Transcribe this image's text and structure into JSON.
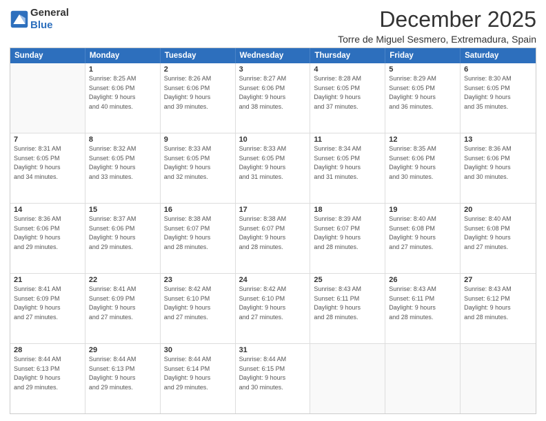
{
  "header": {
    "logo_general": "General",
    "logo_blue": "Blue",
    "month": "December 2025",
    "location": "Torre de Miguel Sesmero, Extremadura, Spain"
  },
  "days_of_week": [
    "Sunday",
    "Monday",
    "Tuesday",
    "Wednesday",
    "Thursday",
    "Friday",
    "Saturday"
  ],
  "weeks": [
    [
      {
        "day": "",
        "sunrise": "",
        "sunset": "",
        "daylight": ""
      },
      {
        "day": "1",
        "sunrise": "Sunrise: 8:25 AM",
        "sunset": "Sunset: 6:06 PM",
        "daylight": "Daylight: 9 hours and 40 minutes."
      },
      {
        "day": "2",
        "sunrise": "Sunrise: 8:26 AM",
        "sunset": "Sunset: 6:06 PM",
        "daylight": "Daylight: 9 hours and 39 minutes."
      },
      {
        "day": "3",
        "sunrise": "Sunrise: 8:27 AM",
        "sunset": "Sunset: 6:06 PM",
        "daylight": "Daylight: 9 hours and 38 minutes."
      },
      {
        "day": "4",
        "sunrise": "Sunrise: 8:28 AM",
        "sunset": "Sunset: 6:05 PM",
        "daylight": "Daylight: 9 hours and 37 minutes."
      },
      {
        "day": "5",
        "sunrise": "Sunrise: 8:29 AM",
        "sunset": "Sunset: 6:05 PM",
        "daylight": "Daylight: 9 hours and 36 minutes."
      },
      {
        "day": "6",
        "sunrise": "Sunrise: 8:30 AM",
        "sunset": "Sunset: 6:05 PM",
        "daylight": "Daylight: 9 hours and 35 minutes."
      }
    ],
    [
      {
        "day": "7",
        "sunrise": "Sunrise: 8:31 AM",
        "sunset": "Sunset: 6:05 PM",
        "daylight": "Daylight: 9 hours and 34 minutes."
      },
      {
        "day": "8",
        "sunrise": "Sunrise: 8:32 AM",
        "sunset": "Sunset: 6:05 PM",
        "daylight": "Daylight: 9 hours and 33 minutes."
      },
      {
        "day": "9",
        "sunrise": "Sunrise: 8:33 AM",
        "sunset": "Sunset: 6:05 PM",
        "daylight": "Daylight: 9 hours and 32 minutes."
      },
      {
        "day": "10",
        "sunrise": "Sunrise: 8:33 AM",
        "sunset": "Sunset: 6:05 PM",
        "daylight": "Daylight: 9 hours and 31 minutes."
      },
      {
        "day": "11",
        "sunrise": "Sunrise: 8:34 AM",
        "sunset": "Sunset: 6:05 PM",
        "daylight": "Daylight: 9 hours and 31 minutes."
      },
      {
        "day": "12",
        "sunrise": "Sunrise: 8:35 AM",
        "sunset": "Sunset: 6:06 PM",
        "daylight": "Daylight: 9 hours and 30 minutes."
      },
      {
        "day": "13",
        "sunrise": "Sunrise: 8:36 AM",
        "sunset": "Sunset: 6:06 PM",
        "daylight": "Daylight: 9 hours and 30 minutes."
      }
    ],
    [
      {
        "day": "14",
        "sunrise": "Sunrise: 8:36 AM",
        "sunset": "Sunset: 6:06 PM",
        "daylight": "Daylight: 9 hours and 29 minutes."
      },
      {
        "day": "15",
        "sunrise": "Sunrise: 8:37 AM",
        "sunset": "Sunset: 6:06 PM",
        "daylight": "Daylight: 9 hours and 29 minutes."
      },
      {
        "day": "16",
        "sunrise": "Sunrise: 8:38 AM",
        "sunset": "Sunset: 6:07 PM",
        "daylight": "Daylight: 9 hours and 28 minutes."
      },
      {
        "day": "17",
        "sunrise": "Sunrise: 8:38 AM",
        "sunset": "Sunset: 6:07 PM",
        "daylight": "Daylight: 9 hours and 28 minutes."
      },
      {
        "day": "18",
        "sunrise": "Sunrise: 8:39 AM",
        "sunset": "Sunset: 6:07 PM",
        "daylight": "Daylight: 9 hours and 28 minutes."
      },
      {
        "day": "19",
        "sunrise": "Sunrise: 8:40 AM",
        "sunset": "Sunset: 6:08 PM",
        "daylight": "Daylight: 9 hours and 27 minutes."
      },
      {
        "day": "20",
        "sunrise": "Sunrise: 8:40 AM",
        "sunset": "Sunset: 6:08 PM",
        "daylight": "Daylight: 9 hours and 27 minutes."
      }
    ],
    [
      {
        "day": "21",
        "sunrise": "Sunrise: 8:41 AM",
        "sunset": "Sunset: 6:09 PM",
        "daylight": "Daylight: 9 hours and 27 minutes."
      },
      {
        "day": "22",
        "sunrise": "Sunrise: 8:41 AM",
        "sunset": "Sunset: 6:09 PM",
        "daylight": "Daylight: 9 hours and 27 minutes."
      },
      {
        "day": "23",
        "sunrise": "Sunrise: 8:42 AM",
        "sunset": "Sunset: 6:10 PM",
        "daylight": "Daylight: 9 hours and 27 minutes."
      },
      {
        "day": "24",
        "sunrise": "Sunrise: 8:42 AM",
        "sunset": "Sunset: 6:10 PM",
        "daylight": "Daylight: 9 hours and 27 minutes."
      },
      {
        "day": "25",
        "sunrise": "Sunrise: 8:43 AM",
        "sunset": "Sunset: 6:11 PM",
        "daylight": "Daylight: 9 hours and 28 minutes."
      },
      {
        "day": "26",
        "sunrise": "Sunrise: 8:43 AM",
        "sunset": "Sunset: 6:11 PM",
        "daylight": "Daylight: 9 hours and 28 minutes."
      },
      {
        "day": "27",
        "sunrise": "Sunrise: 8:43 AM",
        "sunset": "Sunset: 6:12 PM",
        "daylight": "Daylight: 9 hours and 28 minutes."
      }
    ],
    [
      {
        "day": "28",
        "sunrise": "Sunrise: 8:44 AM",
        "sunset": "Sunset: 6:13 PM",
        "daylight": "Daylight: 9 hours and 29 minutes."
      },
      {
        "day": "29",
        "sunrise": "Sunrise: 8:44 AM",
        "sunset": "Sunset: 6:13 PM",
        "daylight": "Daylight: 9 hours and 29 minutes."
      },
      {
        "day": "30",
        "sunrise": "Sunrise: 8:44 AM",
        "sunset": "Sunset: 6:14 PM",
        "daylight": "Daylight: 9 hours and 29 minutes."
      },
      {
        "day": "31",
        "sunrise": "Sunrise: 8:44 AM",
        "sunset": "Sunset: 6:15 PM",
        "daylight": "Daylight: 9 hours and 30 minutes."
      },
      {
        "day": "",
        "sunrise": "",
        "sunset": "",
        "daylight": ""
      },
      {
        "day": "",
        "sunrise": "",
        "sunset": "",
        "daylight": ""
      },
      {
        "day": "",
        "sunrise": "",
        "sunset": "",
        "daylight": ""
      }
    ]
  ]
}
